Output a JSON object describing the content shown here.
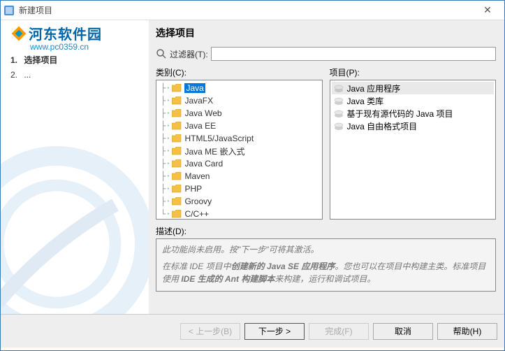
{
  "window": {
    "title": "新建项目",
    "close": "✕"
  },
  "watermark": {
    "text": "河东软件园",
    "sub": "www.pc0359.cn"
  },
  "steps": {
    "items": [
      {
        "num": "1.",
        "label": "选择项目",
        "active": true
      },
      {
        "num": "2.",
        "label": "...",
        "active": false
      }
    ]
  },
  "page": {
    "heading": "选择项目",
    "filter_label": "过滤器(T):",
    "filter_value": "",
    "category_label": "类别(C):",
    "project_label": "项目(P):",
    "desc_label": "描述(D):"
  },
  "categories": [
    {
      "label": "Java",
      "selected": true
    },
    {
      "label": "JavaFX"
    },
    {
      "label": "Java Web"
    },
    {
      "label": "Java EE"
    },
    {
      "label": "HTML5/JavaScript"
    },
    {
      "label": "Java ME 嵌入式"
    },
    {
      "label": "Java Card"
    },
    {
      "label": "Maven"
    },
    {
      "label": "PHP"
    },
    {
      "label": "Groovy"
    },
    {
      "label": "C/C++"
    }
  ],
  "projects": [
    {
      "label": "Java 应用程序",
      "selected": true
    },
    {
      "label": "Java 类库"
    },
    {
      "label": "基于现有源代码的 Java 项目"
    },
    {
      "label": "Java 自由格式项目"
    }
  ],
  "description": {
    "line1": "此功能尚未启用。按\"下一步\"可将其激活。",
    "line2_a": "在标准 IDE 项目中",
    "line2_b": "创建新的 Java SE 应用程序",
    "line2_c": "。您也可以在项目中构建主类。标准项目使用 ",
    "line2_d": "IDE 生成的 Ant 构建脚本",
    "line2_e": "来构建，运行和调试项目。"
  },
  "buttons": {
    "back": "< 上一步(B)",
    "next": "下一步 >",
    "finish": "完成(F)",
    "cancel": "取消",
    "help": "帮助(H)"
  },
  "colors": {
    "accent": "#0078d7",
    "folder": "#f6c048"
  }
}
